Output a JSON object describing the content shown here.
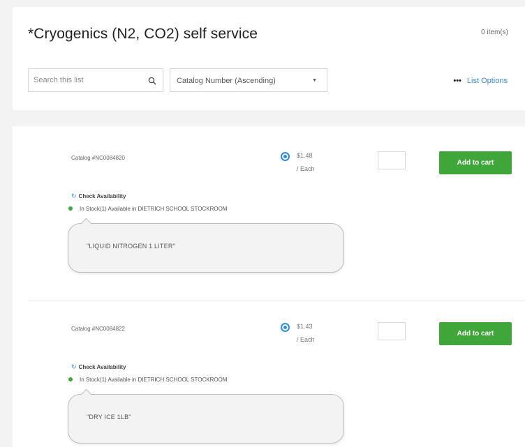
{
  "header": {
    "title": "*Cryogenics (N2, CO2) self service",
    "item_count": "0 item(s)",
    "search": {
      "placeholder": "Search this list"
    },
    "sort": {
      "selected": "Catalog Number (Ascending)"
    },
    "list_options_label": "List Options"
  },
  "items": [
    {
      "catalog": "Catalog #NC0084820",
      "price": "$1.48",
      "unit": "/ Each",
      "quantity": "",
      "add_label": "Add to cart",
      "check_availability": "Check Availability",
      "stock": "In Stock(1) Available in DIETRICH SCHOOL STOCKROOM",
      "note": "\"LIQUID NITROGEN 1 LITER\""
    },
    {
      "catalog": "Catalog #NC0084822",
      "price": "$1.43",
      "unit": "/ Each",
      "quantity": "",
      "add_label": "Add to cart",
      "check_availability": "Check Availability",
      "stock": "In Stock(1) Available in DIETRICH SCHOOL STOCKROOM",
      "note": "\"DRY ICE 1LB\""
    }
  ],
  "colors": {
    "accent_blue": "#3d8ad3",
    "add_button_green": "#3fa639",
    "stock_dot_green": "#3fa639"
  },
  "icons": {
    "search": "search-icon",
    "refresh": "refresh-icon",
    "more": "more-dots-icon",
    "caret": "chevron-down-icon"
  }
}
